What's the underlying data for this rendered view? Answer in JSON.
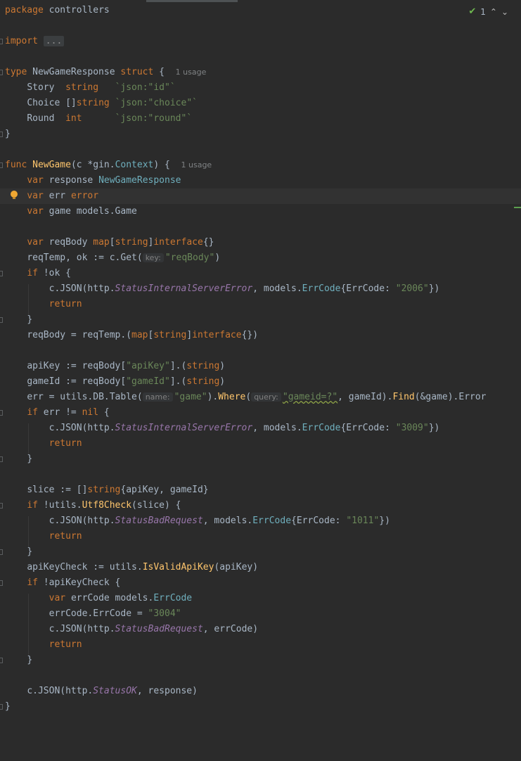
{
  "status": {
    "check_count": "1"
  },
  "hints": {
    "usage": "1 usage",
    "key": "key:",
    "name": "name:",
    "query": "query:"
  },
  "code": {
    "l1": [
      "package",
      "controllers"
    ],
    "l2": [
      "import",
      "..."
    ],
    "l3": [
      "type",
      "NewGameResponse",
      "struct",
      "{"
    ],
    "l4": [
      "Story",
      "string",
      "`json:",
      "\"id\"",
      "`"
    ],
    "l5": [
      "Choice",
      "[]",
      "string",
      "`json:",
      "\"choice\"",
      "`"
    ],
    "l6": [
      "Round",
      "int",
      "`json:",
      "\"round\"",
      "`"
    ],
    "l7": [
      "}"
    ],
    "l8": [
      "func",
      "NewGame",
      "(c *",
      "gin",
      ".",
      "Context",
      ") {"
    ],
    "l9": [
      "var",
      "response",
      "NewGameResponse"
    ],
    "l10": [
      "var",
      "err",
      "error"
    ],
    "l11": [
      "var",
      "game models.",
      "Game"
    ],
    "l12": [
      "var",
      "reqBody",
      "map",
      "[",
      "string",
      "]",
      "interface",
      "{}"
    ],
    "l13": [
      "reqTemp",
      ", ok := c.Get(",
      "\"reqBody\"",
      ")"
    ],
    "l14": [
      "if",
      " !ok {"
    ],
    "l15": [
      "c.JSON(http.",
      "StatusInternalServerError",
      ", models.",
      "ErrCode",
      "{ErrCode: ",
      "\"2006\"",
      "})"
    ],
    "l16": [
      "return"
    ],
    "l17": [
      "}"
    ],
    "l18": [
      "reqBody = reqTemp.(",
      "map",
      "[",
      "string",
      "]",
      "interface",
      "{})"
    ],
    "l19": [
      "apiKey := reqBody[",
      "\"apiKey\"",
      "].(",
      "string",
      ")"
    ],
    "l20": [
      "gameId := reqBody[",
      "\"gameId\"",
      "].(",
      "string",
      ")"
    ],
    "l21": [
      "err = ",
      "utils",
      ".DB.Table(",
      "\"game\"",
      ").",
      "Where",
      "(",
      "\"gameid=?\"",
      ", gameId).",
      "Find",
      "(&game).Error"
    ],
    "l22": [
      "if",
      " err != ",
      "nil",
      " {"
    ],
    "l23": [
      "c.JSON(http.",
      "StatusInternalServerError",
      ", models.",
      "ErrCode",
      "{ErrCode: ",
      "\"3009\"",
      "})"
    ],
    "l24": [
      "return"
    ],
    "l25": [
      "}"
    ],
    "l26": [
      "slice := []",
      "string",
      "{apiKey, gameId}"
    ],
    "l27": [
      "if",
      " !",
      "utils",
      ".",
      "Utf8Check",
      "(slice) {"
    ],
    "l28": [
      "c.JSON(http.",
      "StatusBadRequest",
      ", models.",
      "ErrCode",
      "{ErrCode: ",
      "\"1011\"",
      "})"
    ],
    "l29": [
      "return"
    ],
    "l30": [
      "}"
    ],
    "l31": [
      "apiKeyCheck := ",
      "utils",
      ".",
      "IsValidApiKey",
      "(apiKey)"
    ],
    "l32": [
      "if",
      " !apiKeyCheck {"
    ],
    "l33": [
      "var",
      "errCode models.",
      "ErrCode"
    ],
    "l34": [
      "errCode.ErrCode = ",
      "\"3004\""
    ],
    "l35": [
      "c.JSON(http.",
      "StatusBadRequest",
      ", errCode)"
    ],
    "l36": [
      "return"
    ],
    "l37": [
      "}"
    ],
    "l38": [
      "c.JSON(http.",
      "StatusOK",
      ", response)"
    ],
    "l39": [
      "}"
    ]
  }
}
